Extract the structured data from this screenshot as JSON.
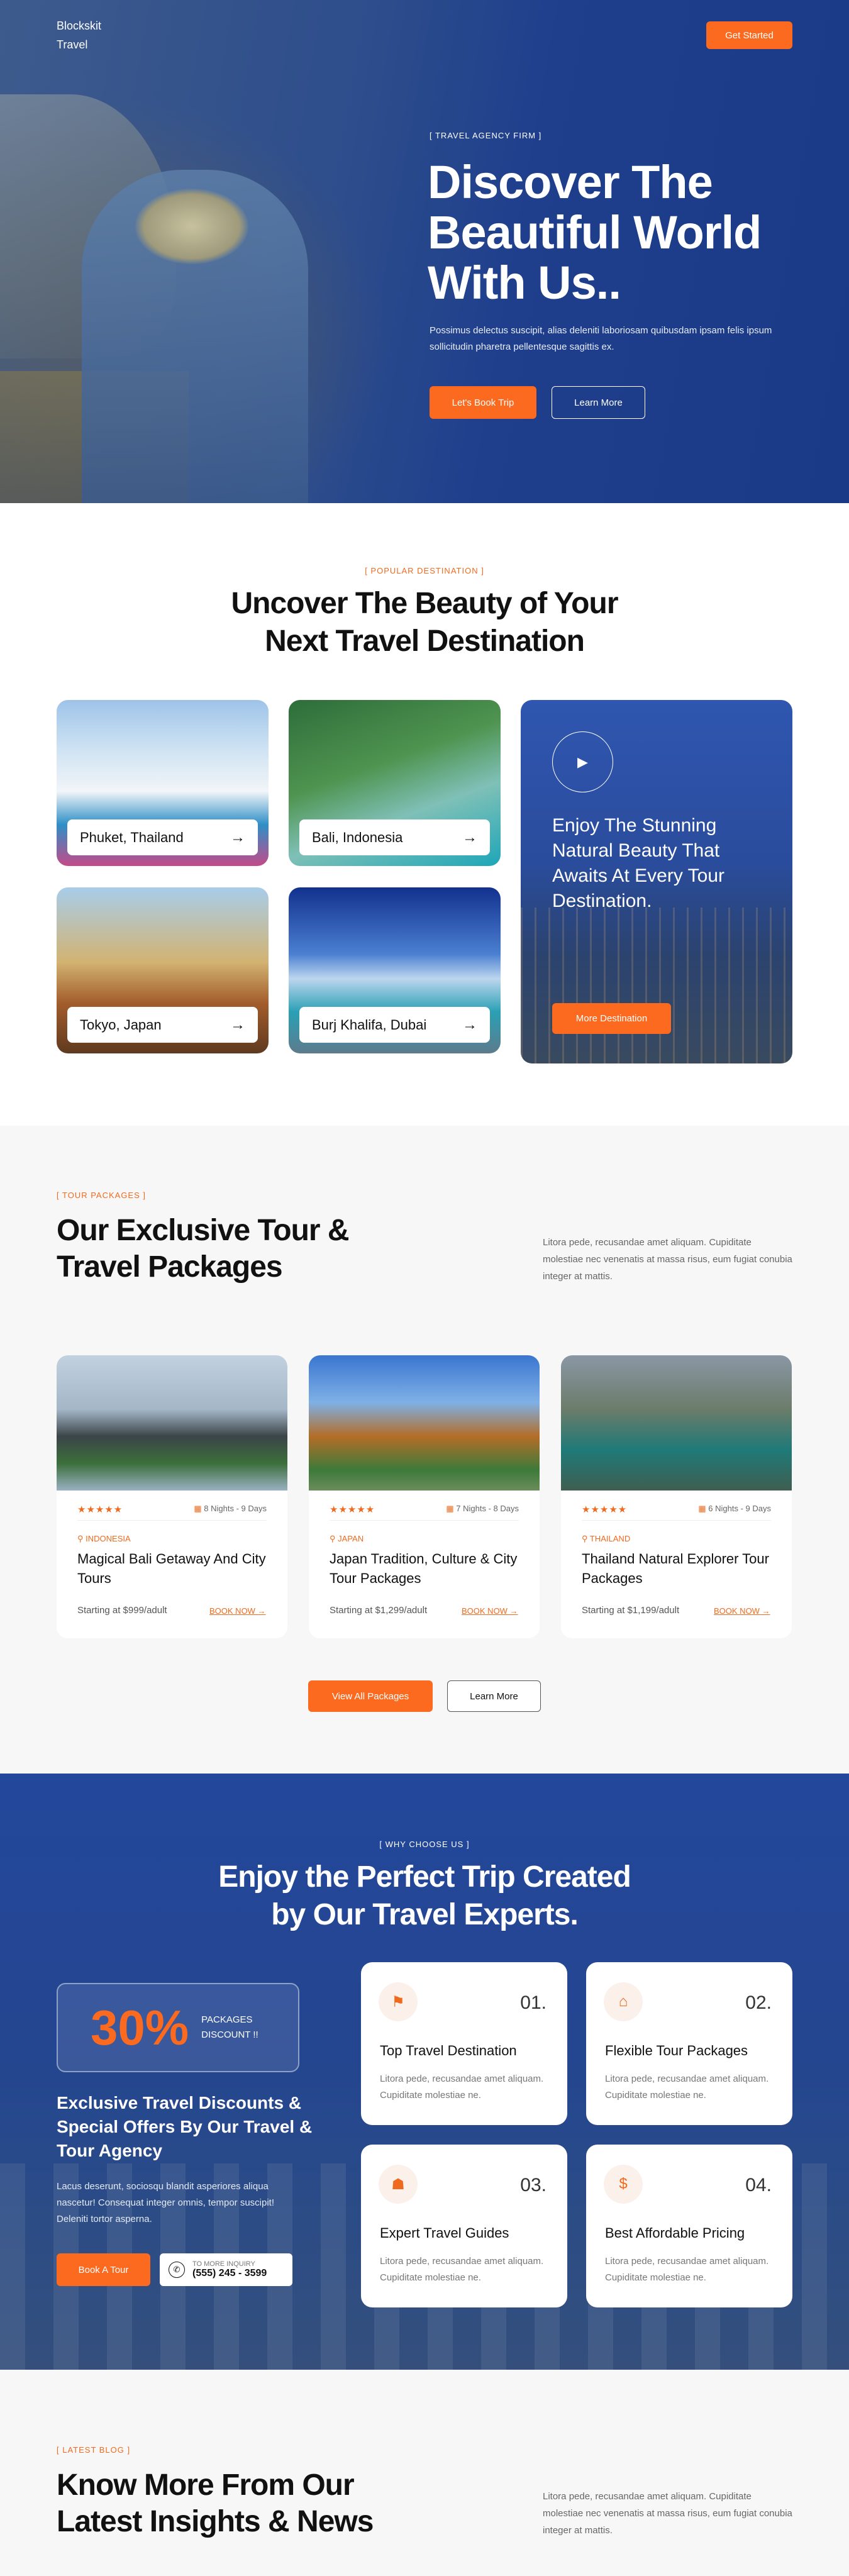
{
  "header": {
    "logo_line1": "Blockskit",
    "logo_line2": "Travel",
    "cta_label": "Get Started"
  },
  "hero": {
    "eyebrow": "[ TRAVEL AGENCY FIRM ]",
    "title": "Discover The Beautiful World With Us..",
    "subtitle": "Possimus delectus suscipit, alias deleniti laboriosam quibusdam ipsam felis ipsum sollicitudin pharetra pellentesque sagittis ex.",
    "primary_button": "Let's Book Trip",
    "secondary_button": "Learn More"
  },
  "destinations": {
    "eyebrow": "[ POPULAR DESTINATION ]",
    "title_line1": "Uncover The Beauty of Your",
    "title_line2": "Next Travel Destination",
    "items": [
      {
        "label": "Phuket, Thailand"
      },
      {
        "label": "Bali, Indonesia"
      },
      {
        "label": "Tokyo, Japan"
      },
      {
        "label": "Burj Khalifa, Dubai"
      }
    ],
    "promo": {
      "text": "Enjoy The Stunning Natural Beauty That Awaits At Every Tour Destination.",
      "button": "More Destination"
    }
  },
  "tours": {
    "eyebrow": "[ TOUR PACKAGES ]",
    "title_line1": "Our Exclusive Tour &",
    "title_line2": "Travel Packages",
    "description": "Litora pede, recusandae amet aliquam. Cupiditate molestiae nec venenatis at massa risus, eum fugiat conubia integer at mattis.",
    "cards": [
      {
        "stars": "★★★★★",
        "duration": "8 Nights - 9 Days",
        "location": "INDONESIA",
        "name": "Magical Bali Getaway And City Tours",
        "price": "Starting at $999/adult",
        "book": "BOOK NOW →"
      },
      {
        "stars": "★★★★★",
        "duration": "7 Nights - 8 Days",
        "location": "JAPAN",
        "name": "Japan Tradition, Culture & City Tour Packages",
        "price": "Starting at $1,299/adult",
        "book": "BOOK NOW →"
      },
      {
        "stars": "★★★★★",
        "duration": "6 Nights - 9 Days",
        "location": "THAILAND",
        "name": "Thailand Natural Explorer Tour Packages",
        "price": "Starting at $1,199/adult",
        "book": "BOOK NOW →"
      }
    ],
    "primary_button": "View All Packages",
    "secondary_button": "Learn More"
  },
  "why": {
    "eyebrow": "[ WHY CHOOSE US ]",
    "title_line1": "Enjoy the Perfect Trip Created",
    "title_line2": "by Our Travel Experts.",
    "discount_value": "30%",
    "discount_label": "PACKAGES DISCOUNT !!",
    "heading": "Exclusive Travel Discounts & Special Offers By Our Travel & Tour Agency",
    "paragraph": "Lacus deserunt, sociosqu blandit asperiores aliqua nascetur! Consequat integer omnis, tempor suscipit! Deleniti tortor aspernа.",
    "button": "Book A Tour",
    "phone_label": "TO MORE INQUIRY",
    "phone_number": "(555) 245 - 3599",
    "features": [
      {
        "number": "01.",
        "title": "Top Travel Destination",
        "desc": "Litora pede, recusandae amet aliquam. Cupiditate molestiae ne.",
        "icon": "map-pin-icon"
      },
      {
        "number": "02.",
        "title": "Flexible Tour Packages",
        "desc": "Litora pede, recusandae amet aliquam. Cupiditate molestiae ne.",
        "icon": "luggage-icon"
      },
      {
        "number": "03.",
        "title": "Expert Travel Guides",
        "desc": "Litora pede, recusandae amet aliquam. Cupiditate molestiae ne.",
        "icon": "guide-icon"
      },
      {
        "number": "04.",
        "title": "Best Affordable Pricing",
        "desc": "Litora pede, recusandae amet aliquam. Cupiditate molestiae ne.",
        "icon": "price-tag-icon"
      }
    ]
  },
  "blog": {
    "eyebrow": "[ LATEST BLOG ]",
    "title_line1": "Know More From Our",
    "title_line2": "Latest Insights & News",
    "description": "Litora pede, recusandae amet aliquam. Cupiditate molestiae nec venenatis at massa risus, eum fugiat conubia integer at mattis."
  },
  "colors": {
    "accent": "#fb6a1e",
    "hero_blue": "#1f3f8d",
    "section_gray": "#f7f7f8"
  }
}
